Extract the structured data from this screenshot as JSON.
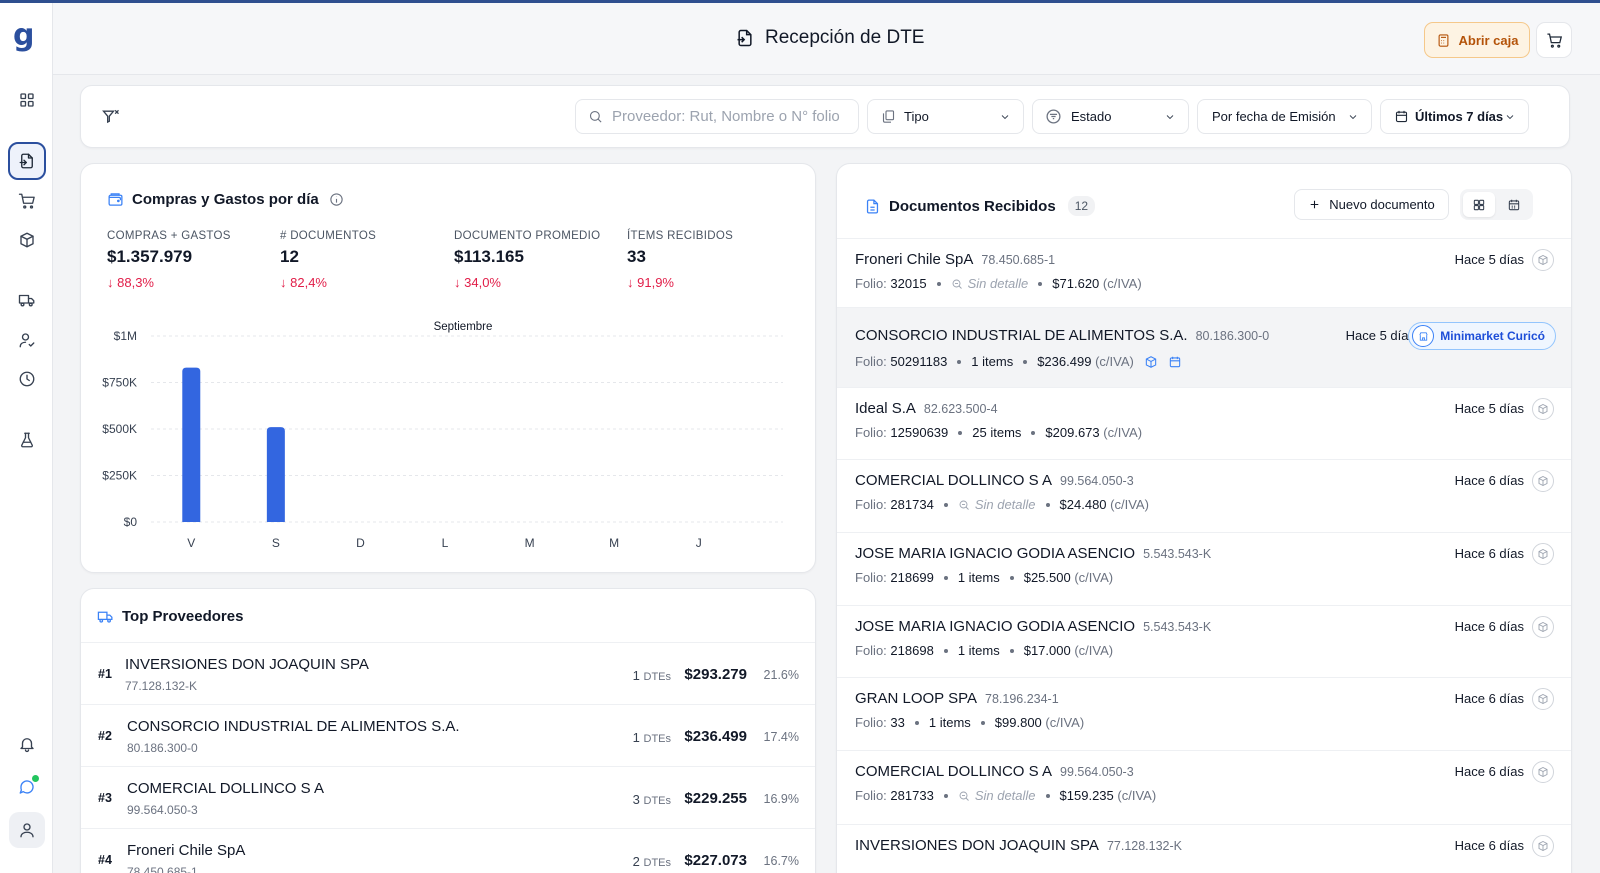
{
  "header": {
    "title": "Recepción de DTE",
    "abrir_caja": "Abrir caja"
  },
  "filters": {
    "search_placeholder": "Proveedor: Rut, Nombre o N° folio",
    "tipo": "Tipo",
    "estado": "Estado",
    "fecha": "Por fecha de Emisión",
    "rango": "Últimos 7 días"
  },
  "stats": {
    "title": "Compras y Gastos por día",
    "kpis": [
      {
        "label": "COMPRAS + GASTOS",
        "value": "$1.357.979",
        "change": "88,3%"
      },
      {
        "label": "# DOCUMENTOS",
        "value": "12",
        "change": "82,4%"
      },
      {
        "label": "DOCUMENTO PROMEDIO",
        "value": "$113.165",
        "change": "34,0%"
      },
      {
        "label": "ÍTEMS RECIBIDOS",
        "value": "33",
        "change": "91,9%"
      }
    ]
  },
  "chart_data": {
    "type": "bar",
    "title": "Septiembre",
    "categories": [
      "V",
      "S",
      "D",
      "L",
      "M",
      "M",
      "J"
    ],
    "values": [
      830000,
      510000,
      0,
      0,
      0,
      0,
      0
    ],
    "ylim": [
      0,
      1000000
    ],
    "yticks": [
      "$0",
      "$250K",
      "$500K",
      "$750K",
      "$1M"
    ],
    "grid": true,
    "bar_color": "#3366e0"
  },
  "top": {
    "title": "Top Proveedores",
    "dtes_label": "DTEs",
    "rows": [
      {
        "rank": "#1",
        "name": "INVERSIONES DON JOAQUIN SPA",
        "rut": "77.128.132-K",
        "dtes": "1",
        "amount": "$293.279",
        "pct": "21.6%"
      },
      {
        "rank": "#2",
        "name": "CONSORCIO INDUSTRIAL DE ALIMENTOS S.A.",
        "rut": "80.186.300-0",
        "dtes": "1",
        "amount": "$236.499",
        "pct": "17.4%"
      },
      {
        "rank": "#3",
        "name": "COMERCIAL DOLLINCO S A",
        "rut": "99.564.050-3",
        "dtes": "3",
        "amount": "$229.255",
        "pct": "16.9%"
      },
      {
        "rank": "#4",
        "name": "Froneri Chile SpA",
        "rut": "78.450.685-1",
        "dtes": "2",
        "amount": "$227.073",
        "pct": "16.7%"
      }
    ]
  },
  "docs": {
    "title": "Documentos Recibidos",
    "count": "12",
    "new_button": "Nuevo documento",
    "folio_label": "Folio:",
    "rows": [
      {
        "name": "Froneri Chile SpA",
        "rut": "78.450.685-1",
        "folio": "32015",
        "items": "Sin detalle",
        "detail": false,
        "amount": "$71.620",
        "iva": "(c/IVA)",
        "time": "Hace 5 días"
      },
      {
        "name": "CONSORCIO INDUSTRIAL DE ALIMENTOS S.A.",
        "rut": "80.186.300-0",
        "folio": "50291183",
        "items": "1 items",
        "detail": true,
        "amount": "$236.499",
        "iva": "(c/IVA)",
        "time": "Hace 5 días",
        "store": "Minimarket Curicó"
      },
      {
        "name": "Ideal S.A",
        "rut": "82.623.500-4",
        "folio": "12590639",
        "items": "25 items",
        "detail": true,
        "amount": "$209.673",
        "iva": "(c/IVA)",
        "time": "Hace 5 días"
      },
      {
        "name": "COMERCIAL DOLLINCO S A",
        "rut": "99.564.050-3",
        "folio": "281734",
        "items": "Sin detalle",
        "detail": false,
        "amount": "$24.480",
        "iva": "(c/IVA)",
        "time": "Hace 6 días"
      },
      {
        "name": "JOSE MARIA IGNACIO GODIA ASENCIO",
        "rut": "5.543.543-K",
        "folio": "218699",
        "items": "1 items",
        "detail": true,
        "amount": "$25.500",
        "iva": "(c/IVA)",
        "time": "Hace 6 días"
      },
      {
        "name": "JOSE MARIA IGNACIO GODIA ASENCIO",
        "rut": "5.543.543-K",
        "folio": "218698",
        "items": "1 items",
        "detail": true,
        "amount": "$17.000",
        "iva": "(c/IVA)",
        "time": "Hace 6 días"
      },
      {
        "name": "GRAN LOOP SPA",
        "rut": "78.196.234-1",
        "folio": "33",
        "items": "1 items",
        "detail": true,
        "amount": "$99.800",
        "iva": "(c/IVA)",
        "time": "Hace 6 días"
      },
      {
        "name": "COMERCIAL DOLLINCO S A",
        "rut": "99.564.050-3",
        "folio": "281733",
        "items": "Sin detalle",
        "detail": false,
        "amount": "$159.235",
        "iva": "(c/IVA)",
        "time": "Hace 6 días"
      },
      {
        "name": "INVERSIONES DON JOAQUIN SPA",
        "rut": "77.128.132-K",
        "time": "Hace 6 días"
      }
    ]
  }
}
